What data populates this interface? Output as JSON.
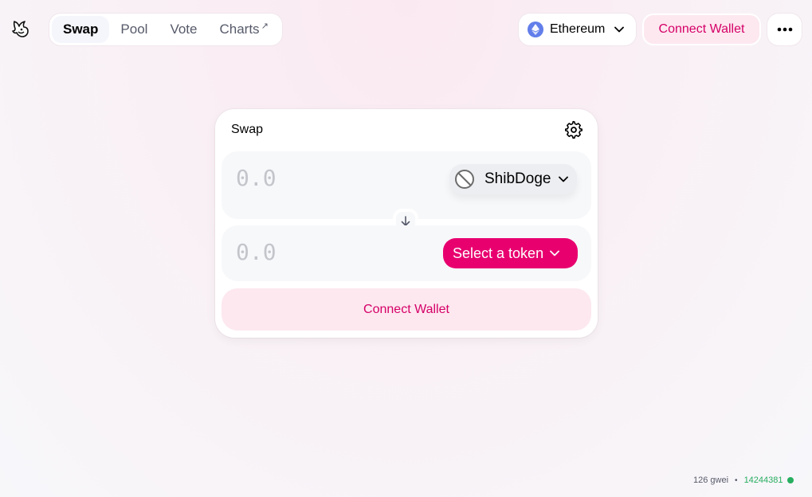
{
  "nav": {
    "items": [
      {
        "label": "Swap",
        "active": true
      },
      {
        "label": "Pool",
        "active": false
      },
      {
        "label": "Vote",
        "active": false
      },
      {
        "label": "Charts",
        "active": false,
        "external_mark": "↗"
      }
    ]
  },
  "network": {
    "label": "Ethereum",
    "icon": "ethereum-icon"
  },
  "header": {
    "connect_label": "Connect Wallet",
    "more_icon": "more-horizontal-icon"
  },
  "swap": {
    "title": "Swap",
    "settings_icon": "gear-icon",
    "input": {
      "amount_placeholder": "0.0",
      "token": "ShibDoge",
      "token_icon": "ban-icon"
    },
    "output": {
      "amount_placeholder": "0.0",
      "select_label": "Select a token"
    },
    "switch_icon": "arrow-down-icon",
    "connect_label": "Connect Wallet"
  },
  "footer": {
    "gas": "126 gwei",
    "separator": "•",
    "block_number": "14244381"
  },
  "colors": {
    "accent": "#e8006f",
    "accent_text": "#d50066",
    "accent_light": "#fde8f0",
    "panel": "#f7f8fa",
    "placeholder": "#c3c5cb",
    "live": "#27ae60"
  }
}
